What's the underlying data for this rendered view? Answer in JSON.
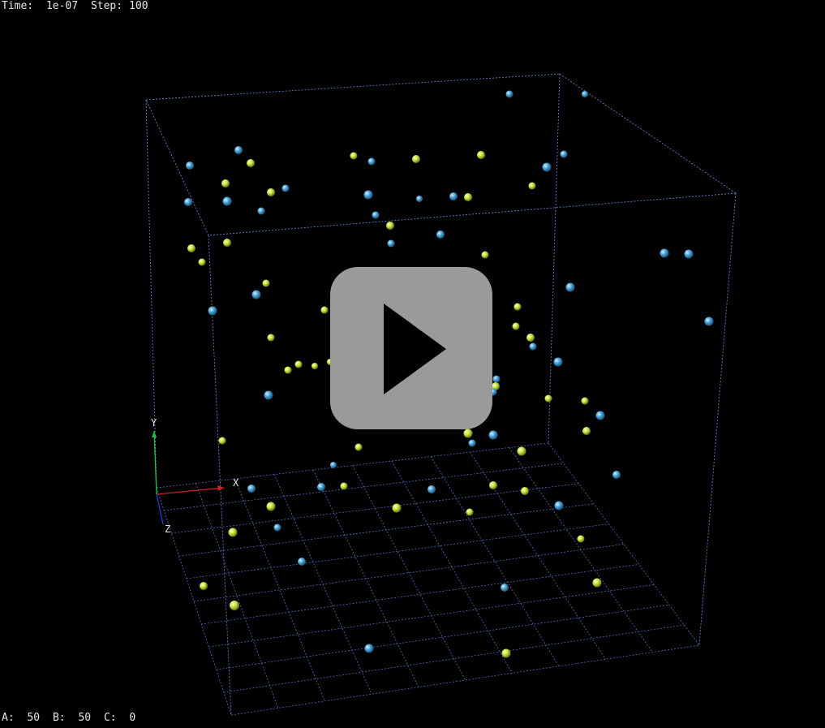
{
  "hud": {
    "time_label": "Time:",
    "time_value": "1e-07",
    "step_label": "Step:",
    "step_value": "100",
    "count_a_label": "A:",
    "count_a_value": "50",
    "count_b_label": "B:",
    "count_b_value": "50",
    "count_c_label": "C:",
    "count_c_value": "0"
  },
  "axes": {
    "x_label": "X",
    "y_label": "Y",
    "z_label": "Z"
  },
  "colors": {
    "species_a": "#4aa3d8",
    "species_b": "#c6e63a",
    "box_lines": "#5f7fc8",
    "axis_x": "#d02020",
    "axis_y": "#20c040",
    "axis_z": "#2040d0",
    "play_button": "#9a9a9a"
  },
  "icons": {
    "play": "play-icon"
  }
}
